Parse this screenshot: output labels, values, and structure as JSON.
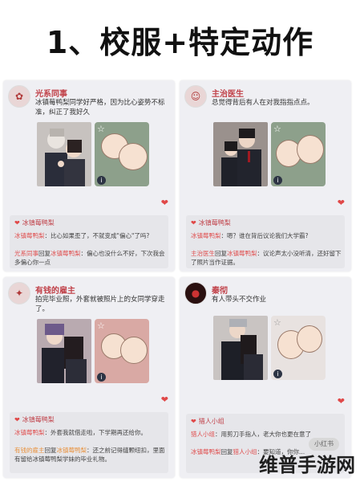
{
  "title": "1、校服+特定动作",
  "cards": [
    {
      "name": "光系同事",
      "text": "冰镇莓鸭梨同学好严格，因为比心姿势不标准，纠正了我好久",
      "reply_title": "冰镇莓鸭梨",
      "reply_lines": [
        {
          "who": "冰镇莓鸭梨",
          "sep": "：",
          "msg": "比心如果歪了，不就变成\"偏心\"了吗?"
        },
        {
          "who": "光系同事",
          "sep": "回复",
          "who2": "冰镇莓鸭梨",
          "msg": "：偏心也没什么不好，下次我会多偏心你一点"
        }
      ]
    },
    {
      "name": "主治医生",
      "text": "总觉得背后有人在对我指指点点。",
      "reply_title": "冰镇莓鸭梨",
      "reply_lines": [
        {
          "who": "冰镇莓鸭梨",
          "sep": "：",
          "msg": "嗯？谁在背后议论我们大学霸?"
        },
        {
          "who": "主治医生",
          "sep": "回复",
          "who2": "冰镇莓鸭梨",
          "msg": "：议论声太小没听清，还好留下了照片当作证据。"
        }
      ]
    },
    {
      "name": "有钱的雇主",
      "text": "拍完毕业照，外套就被照片上的女同学穿走了。",
      "reply_title": "冰镇莓鸭梨",
      "reply_lines": [
        {
          "who": "冰镇莓鸭梨",
          "sep": "：",
          "msg": "外套我就借走啦，下学期再还给你。"
        },
        {
          "who": "有钱的雇主",
          "sep": "回复",
          "who2": "冰镇莓鸭梨",
          "msg": "：还之前记得缝颗纽扣，里面有留给冰镇莓鸭梨学妹的毕业礼物。"
        }
      ]
    },
    {
      "name": "秦彻",
      "text": "有人带头不交作业",
      "reply_title": "猎人小组",
      "reply_lines": [
        {
          "who": "猎人小组",
          "sep": "：",
          "msg": "用剪刀手指人，老大你也更在意了"
        },
        {
          "who": "冰镇莓鸭梨",
          "sep": "回复",
          "who2": "猎人小组",
          "msg": "：要知道，你你..."
        }
      ]
    }
  ],
  "watermark": "维普手游网",
  "badge": "小红书",
  "colors": {
    "accent": "#c04048",
    "heart": "#e04848",
    "card_bg": "#efeff3"
  }
}
